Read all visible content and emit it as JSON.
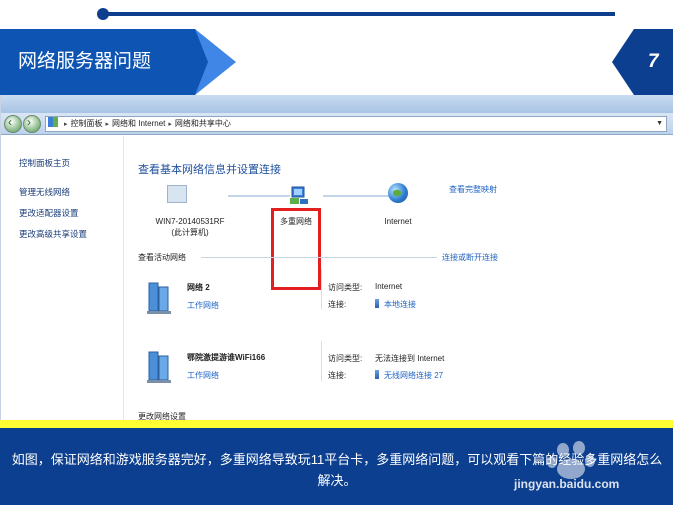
{
  "slide": {
    "title": "网络服务器问题",
    "page_number": "7",
    "caption": "如图，保证网络和游戏服务器完好，多重网络导致玩11平台卡，多重网络问题，可以观看下篇的经验多重网络怎么解决。",
    "watermark": "jingyan.baidu.com"
  },
  "colors": {
    "banner_blue": "#0e55b3",
    "banner_dark": "#0c3f8f",
    "highlight_red": "#e41f1f",
    "accent_yellow": "#ffff33",
    "link_blue": "#1f64c4"
  },
  "explorer": {
    "breadcrumb": [
      "控制面板",
      "网络和 Internet",
      "网络和共享中心"
    ],
    "sidebar": [
      "控制面板主页",
      "管理无线网络",
      "更改适配器设置",
      "更改高级共享设置"
    ],
    "main_title": "查看基本网络信息并设置连接",
    "view_full_map": "查看完整映射",
    "nodes": {
      "computer_name": "WIN7-20140531RF",
      "computer_sub": "(此计算机)",
      "multi_network": "多重网络",
      "internet": "Internet"
    },
    "active_networks_label": "查看活动网络",
    "connect_disconnect": "连接或断开连接",
    "networks": [
      {
        "name": "网络  2",
        "type": "工作网络",
        "access_label": "访问类型:",
        "access_value": "Internet",
        "conn_label": "连接:",
        "conn_value": "本地连接"
      },
      {
        "name": "鄂院激提游谁WiFi166",
        "type": "工作网络",
        "access_label": "访问类型:",
        "access_value": "无法连接到 Internet",
        "conn_label": "连接:",
        "conn_value": "无线网络连接 27"
      }
    ],
    "change_settings": "更改网络设置"
  }
}
